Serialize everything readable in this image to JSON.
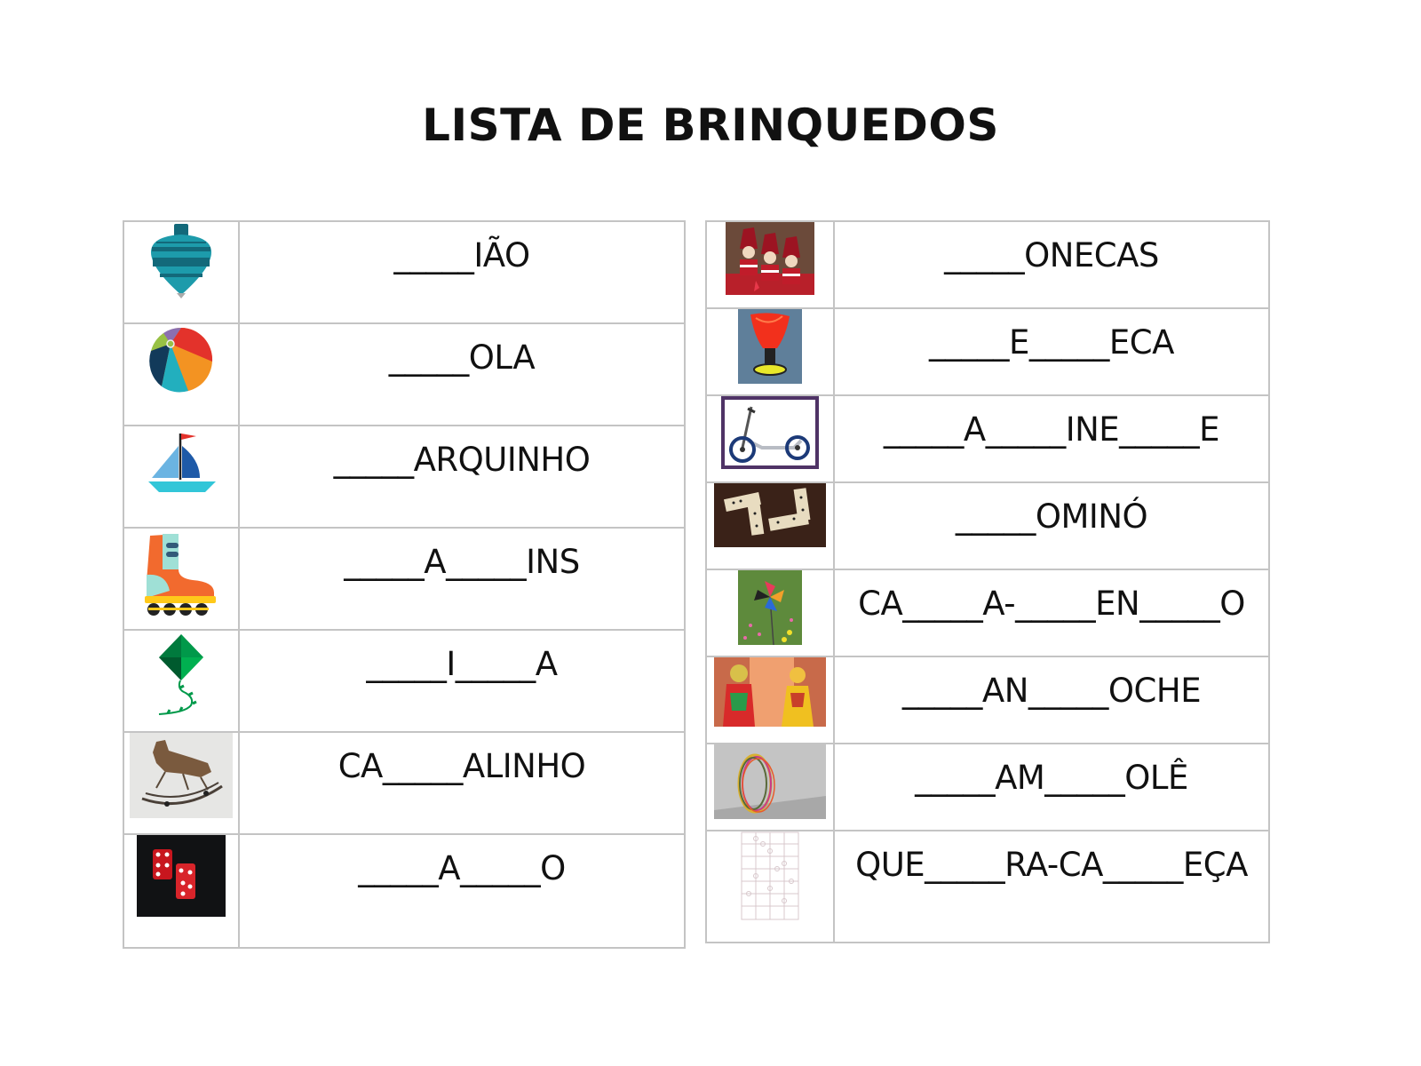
{
  "title": "LISTA DE BRINQUEDOS",
  "left_column": [
    {
      "icon": "spinning-top-icon",
      "word": "_____IÃO"
    },
    {
      "icon": "beach-ball-icon",
      "word": "_____OLA"
    },
    {
      "icon": "sailboat-icon",
      "word": "_____ARQUINHO"
    },
    {
      "icon": "roller-skate-icon",
      "word": "_____A_____INS"
    },
    {
      "icon": "kite-icon",
      "word": "_____I_____A"
    },
    {
      "icon": "rocking-horse-image",
      "word": "CA_____ALINHO"
    },
    {
      "icon": "dice-image",
      "word": "_____A_____O"
    }
  ],
  "right_column": [
    {
      "icon": "dolls-image",
      "word": "_____ONECAS"
    },
    {
      "icon": "peteca-shuttlecock-image",
      "word": "_____E_____ECA"
    },
    {
      "icon": "scooter-image",
      "word": "_____A_____INE_____E"
    },
    {
      "icon": "dominoes-image",
      "word": "_____OMINÓ"
    },
    {
      "icon": "pinwheel-image",
      "word": "CA_____A-_____EN_____O"
    },
    {
      "icon": "puppets-image",
      "word": "_____AN_____OCHE"
    },
    {
      "icon": "hula-hoop-image",
      "word": "_____AM_____OLÊ"
    },
    {
      "icon": "jigsaw-puzzle-image",
      "word": "QUE_____RA-CA_____EÇA"
    }
  ]
}
